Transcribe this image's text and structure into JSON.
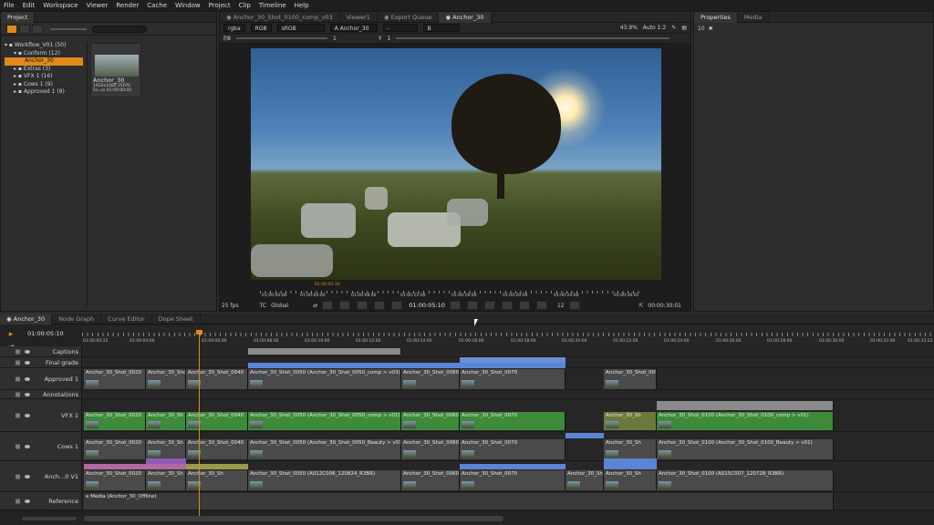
{
  "menu": [
    "File",
    "Edit",
    "Workspace",
    "Viewer",
    "Render",
    "Cache",
    "Window",
    "Project",
    "Clip",
    "Timeline",
    "Help"
  ],
  "project_panel": {
    "tab": "Project",
    "tree": [
      "Workflow_V01 (50)",
      "Conform (12)",
      "Anchor_30",
      "Extras (3)",
      "VFX 1 (16)",
      "Cows 1 (9)",
      "Approved 1 (9)"
    ],
    "selected_index": 2,
    "clip_name": "Anchor_30",
    "clip_info1": "1920x1080    25FPS",
    "clip_info2": "5s..co  01:00:00:00"
  },
  "viewer_tabs": [
    "Anchor_30_Shot_0100_comp_v03",
    "Viewer1",
    "Export Queue",
    "Anchor_30"
  ],
  "viewer": {
    "channels": "rgba",
    "colorspace": "RGB",
    "display": "sRGB",
    "input_a": "A  Anchor_30",
    "input_b": "B",
    "zoom": "43.9%",
    "auto": "Auto 1:2",
    "fstop": "f/8",
    "gain": "1",
    "gamma_y": "Y",
    "gamma_val": "1",
    "fps": "25 fps",
    "tc_mode": "TC",
    "scope": "Global",
    "current_tc": "01:00:05:10",
    "playhead_tc": "01:00:05:10",
    "step": "12",
    "end_tc": "00:00:30:01",
    "scrub_ticks": [
      "01:00:00:00",
      "01:00:04:00",
      "01:00:08:00",
      "01:00:12:00",
      "01:00:16:00",
      "01:00:20:00",
      "01:00:24:00",
      "01:00:30:01"
    ]
  },
  "right_panel": {
    "tabs": [
      "Properties",
      "Media"
    ],
    "count": "10"
  },
  "timeline_tabs": [
    "Anchor_30",
    "Node Graph",
    "Curve Editor",
    "Dope Sheet"
  ],
  "timeline": {
    "current_tc": "01:00:05:10",
    "ruler": [
      "01:00:00:22",
      "01:00:04:00",
      "01:00:06:00",
      "01:00:08:00",
      "01:00:10:00",
      "01:00:12:00",
      "01:00:14:00",
      "01:00:16:00",
      "01:00:18:00",
      "01:00:20:00",
      "01:00:22:00",
      "01:00:24:00",
      "01:00:26:00",
      "01:00:28:00",
      "01:00:30:00",
      "01:00:32:00",
      "01:00:33:23"
    ],
    "tracks": [
      "Captions",
      "Final grade",
      "Approved 1",
      "Annotations",
      "VFX 1",
      "Cows 1",
      "Anch...0 V1",
      "Reference"
    ],
    "approved_clips": [
      "Anchor_30_Shot_0020",
      "Anchor_30_Shot",
      "Anchor_30_Shot_0040",
      "Anchor_30_Shot_0050 (Anchor_30_Shot_0050_comp > v03)",
      "Anchor_30_Shot_0060",
      "Anchor_30_Shot_0070",
      "Anchor_30_Shot_0090"
    ],
    "vfx_clips": [
      "Anchor_30_Shot_0020",
      "Anchor_30_Sh",
      "Anchor_30_Shot_0040",
      "Anchor_30_Shot_0050 (Anchor_30_Shot_0050_comp > v01)",
      "Anchor_30_Shot_0060",
      "Anchor_30_Shot_0070",
      "Anchor_30_Sh",
      "Anchor_30_Shot_0100 (Anchor_30_Shot_0100_comp > v01)"
    ],
    "cows_clips": [
      "Anchor_30_Shot_0020",
      "Anchor_30_Sh",
      "Anchor_30_Shot_0040",
      "Anchor_30_Shot_0050 (Anchor_30_Shot_0050_Beauty > v01)",
      "Anchor_30_Shot_0060",
      "Anchor_30_Shot_0070",
      "Anchor_30_Sh",
      "Anchor_30_Shot_0100 (Anchor_30_Shot_0100_Beauty > v01)"
    ],
    "v1_clips": [
      "Anchor_30_Shot_0020",
      "Anchor_30_Sh",
      "Anchor_30_Sh",
      "Anchor_30_Shot_0050 (A012C006_120824_R3BR)",
      "Anchor_30_Shot_0060",
      "Anchor_30_Shot_0070",
      "Anchor_30_Sh",
      "Anchor_30_Sh",
      "Anchor_30_Shot_0100 (A015C007_120728_R3BR)"
    ],
    "reference_clip": "e Media (Anchor_30_Offline)"
  }
}
